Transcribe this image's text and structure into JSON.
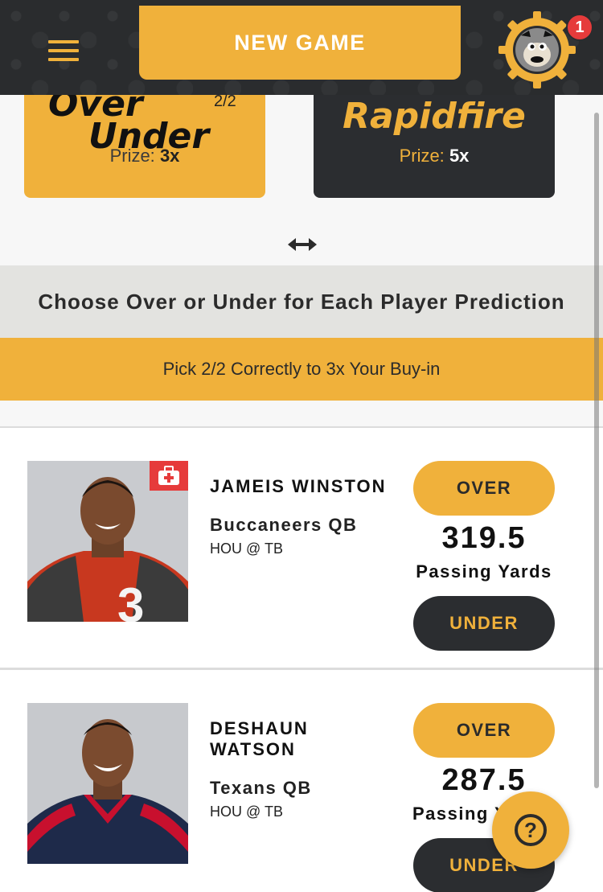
{
  "header": {
    "new_game_label": "NEW GAME",
    "notification_count": "1",
    "menu_icon": "hamburger-menu-icon",
    "avatar_icon": "monkey-gear-avatar"
  },
  "modes": {
    "over_under": {
      "logo_line1": "Over",
      "logo_line2": "Under",
      "count": "2/2",
      "prize_label": "Prize:",
      "prize_value": "3x"
    },
    "rapidfire": {
      "logo": "Rapidfire",
      "prize_label": "Prize:",
      "prize_value": "5x"
    },
    "swap_icon": "double-arrow-icon"
  },
  "instructions": {
    "title": "Choose Over or Under for Each Player Prediction",
    "pick": "Pick 2/2 Correctly to 3x Your Buy-in"
  },
  "players": [
    {
      "name": "JAMEIS WINSTON",
      "team": "Buccaneers QB",
      "matchup": "HOU @ TB",
      "over_label": "OVER",
      "line": "319.5",
      "stat": "Passing Yards",
      "under_label": "UNDER",
      "injury": true
    },
    {
      "name_line1": "DESHAUN",
      "name_line2": "WATSON",
      "team": "Texans QB",
      "matchup": "HOU @ TB",
      "over_label": "OVER",
      "line": "287.5",
      "stat": "Passing Y",
      "under_label": "UNDER"
    }
  ],
  "help": {
    "label": "?"
  },
  "colors": {
    "accent": "#f0b13b",
    "dark": "#2b2d30",
    "alert": "#e63b3b"
  }
}
